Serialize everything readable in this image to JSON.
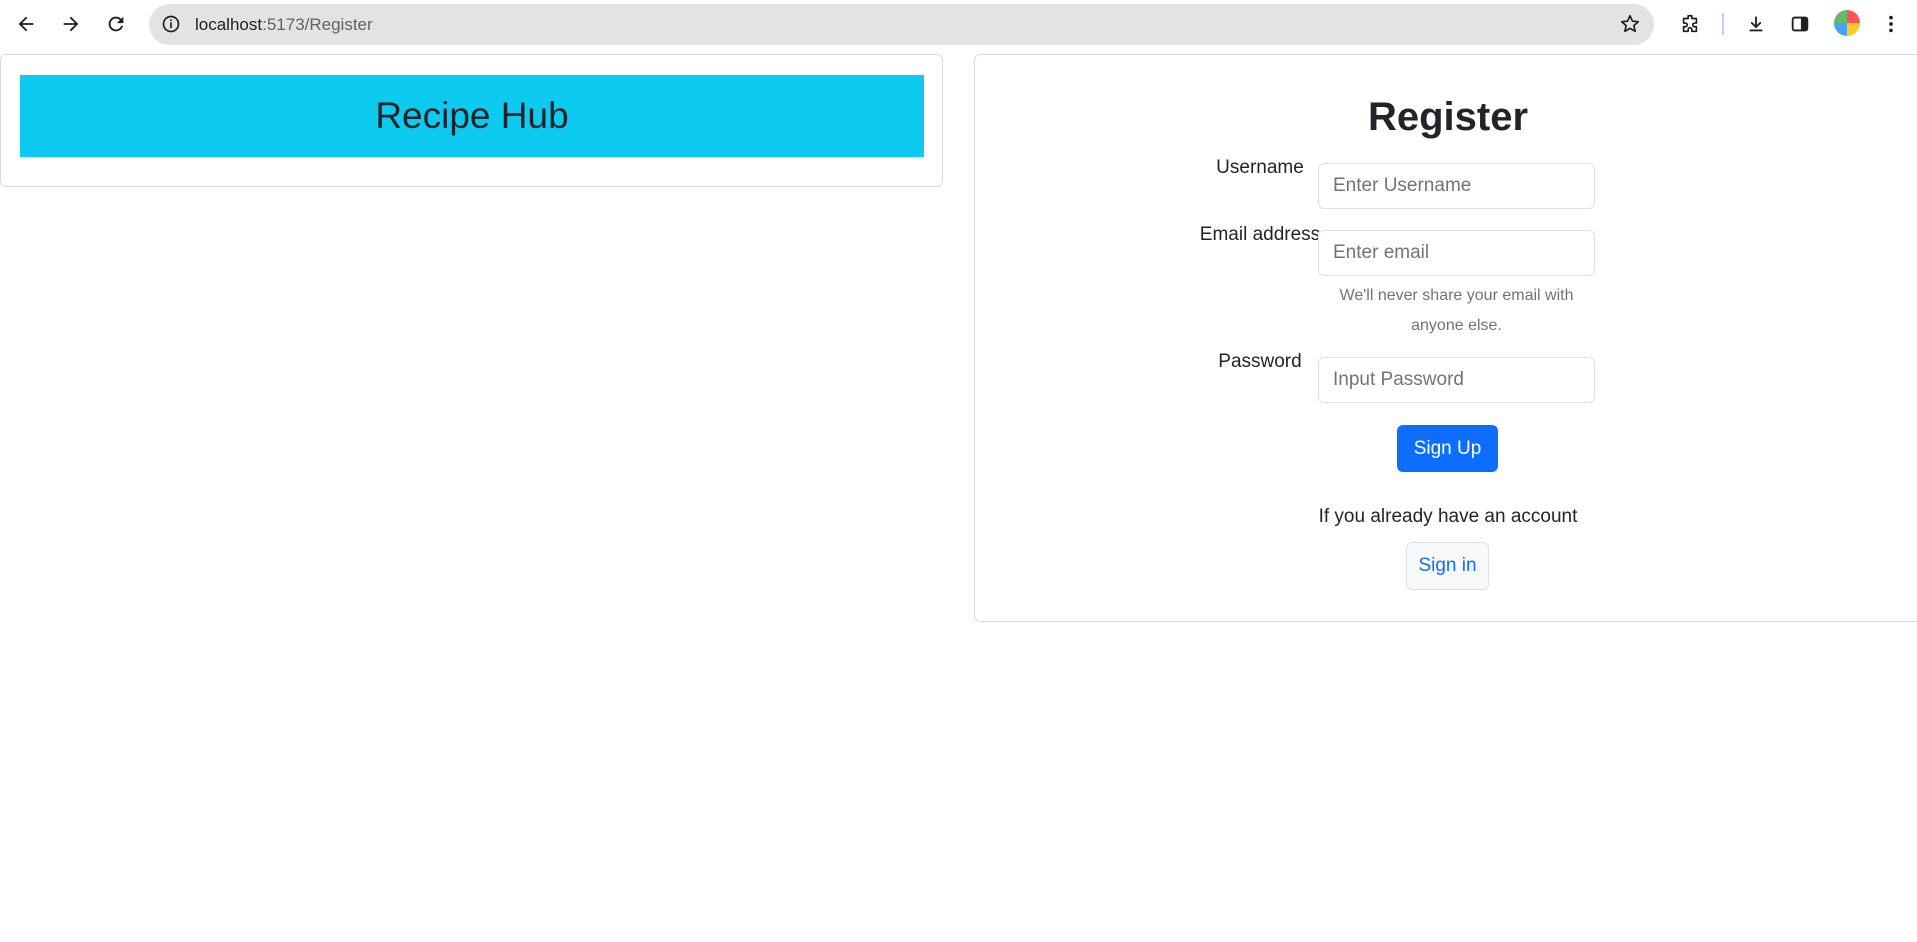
{
  "browser": {
    "url_host": "localhost",
    "url_path": ":5173/Register"
  },
  "brand": {
    "title": "Recipe Hub",
    "color": "#0dcaf0"
  },
  "register": {
    "title": "Register",
    "username_label": "Username",
    "username_placeholder": "Enter Username",
    "email_label": "Email address",
    "email_placeholder": "Enter email",
    "email_help": "We'll never share your email with anyone else.",
    "password_label": "Password",
    "password_placeholder": "Input Password",
    "submit_label": "Sign Up",
    "already_text": "If you already have an account",
    "signin_label": "Sign in",
    "primary_color": "#0d6efd"
  }
}
